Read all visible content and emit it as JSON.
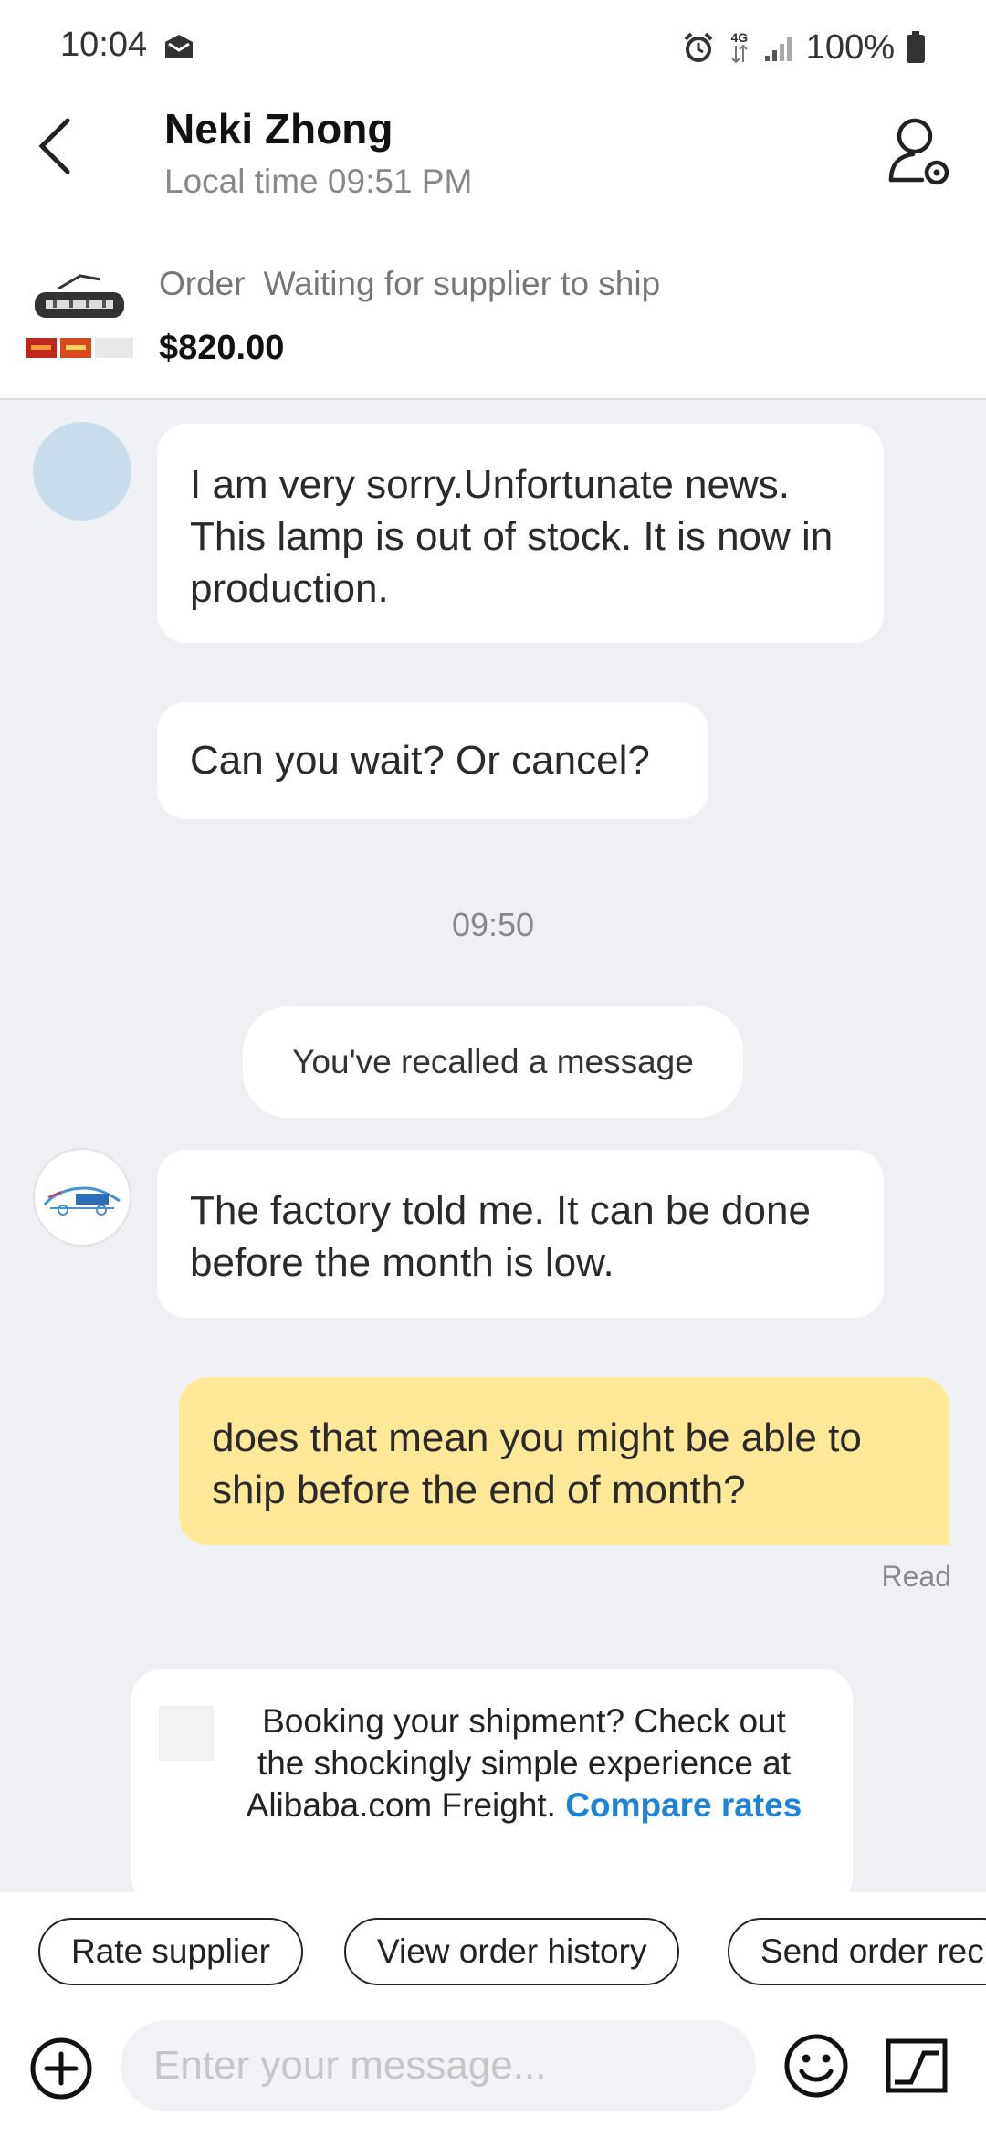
{
  "status_bar": {
    "time": "10:04",
    "network": "4G",
    "battery": "100%",
    "icons": [
      "mail-icon",
      "alarm-icon",
      "network-icon",
      "signal-icon",
      "battery-icon"
    ]
  },
  "header": {
    "contact_name": "Neki Zhong",
    "local_time": "Local time 09:51 PM",
    "icons": [
      "back-arrow-icon",
      "profile-settings-icon"
    ]
  },
  "order": {
    "label": "Order",
    "status": "Waiting for supplier to ship",
    "price": "$820.00"
  },
  "messages": [
    {
      "from": "supplier",
      "text": "I am very sorry.Unfortunate news. This lamp is out of stock. It is now in production."
    },
    {
      "from": "supplier",
      "text": "Can you wait? Or cancel?"
    },
    {
      "from": "supplier",
      "text": "The factory told me. It can be done before the month is low."
    },
    {
      "from": "me",
      "text": "does that mean you might be able to ship before the end of month?"
    }
  ],
  "time_divider": "09:50",
  "recall_notice": "You've recalled a message",
  "read_receipt": "Read",
  "promo": {
    "text": "Booking your shipment? Check out the shockingly simple experience at Alibaba.com Freight.",
    "link": "Compare rates"
  },
  "quick_actions": [
    "Rate supplier",
    "View order history",
    "Send order rec"
  ],
  "composer": {
    "placeholder": "Enter your message...",
    "icons": [
      "add-icon",
      "emoji-icon",
      "image-icon"
    ]
  },
  "colors": {
    "chat_background": "#eff0f4",
    "my_bubble": "#fde897",
    "link": "#1d82d8",
    "avatar_placeholder": "#c8dcec"
  }
}
